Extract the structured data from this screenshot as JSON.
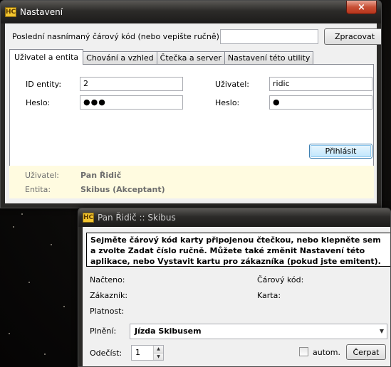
{
  "main_window": {
    "title": "Nastavení",
    "app_icon": "HC",
    "close_glyph": "×",
    "barcode_label": "Poslední nasnímaný čárový kód (nebo vepište ručně):",
    "barcode_value": "",
    "process_button": "Zpracovat",
    "tabs": [
      {
        "label": "Uživatel a entita",
        "active": true
      },
      {
        "label": "Chování a vzhled",
        "active": false
      },
      {
        "label": "Čtečka a server",
        "active": false
      },
      {
        "label": "Nastavení této utility",
        "active": false
      }
    ],
    "entity_id_label": "ID entity:",
    "entity_id_value": "2",
    "password_label_left": "Heslo:",
    "password_value_left": "●●●",
    "user_label": "Uživatel:",
    "user_value": "ridic",
    "password_label_right": "Heslo:",
    "password_value_right": "●",
    "login_button": "Přihlásit",
    "info": {
      "user_label": "Uživatel:",
      "user_value": "Pan Řidič",
      "entity_label": "Entita:",
      "entity_value": "Skibus (Akceptant)"
    }
  },
  "pan_window": {
    "title": "Pan Řidič :: Skibus",
    "app_icon": "HC",
    "instructions": "Sejměte čárový kód karty připojenou čtečkou, nebo klepněte sem a zvolte Zadat číslo ručně. Můžete také změnit Nastavení této aplikace, nebo Vystavit kartu pro zákazníka (pokud jste emitent).",
    "loaded_label": "Načteno:",
    "barcode_label": "Čárový kód:",
    "customer_label": "Zákazník:",
    "card_label": "Karta:",
    "validity_label": "Platnost:",
    "fulfillment_label": "Plnění:",
    "fulfillment_value": "Jízda Skibusem",
    "deduct_label": "Odečíst:",
    "deduct_value": "1",
    "auto_label": "autom.",
    "auto_checked": false,
    "draw_button": "Čerpat"
  },
  "colors": {
    "info_panel_bg": "#fffbe0",
    "close_button": "#c75035",
    "app_icon_bg": "#f3c52f"
  }
}
